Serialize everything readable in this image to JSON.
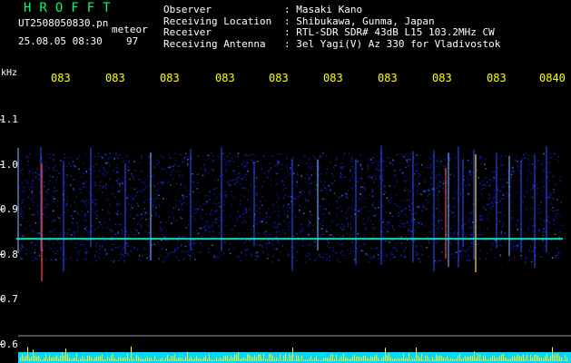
{
  "header": {
    "brand": "HROFFT",
    "filename": "UT2508050830.pn",
    "tag": "meteor",
    "datetime": "25.08.05 08:30",
    "count": "97",
    "info": [
      {
        "label": "Observer",
        "value": ": Masaki Kano"
      },
      {
        "label": "Receiving Location",
        "value": ": Shibukawa, Gunma, Japan"
      },
      {
        "label": "Receiver",
        "value": ": RTL-SDR SDR# 43dB L15 103.2MHz CW"
      },
      {
        "label": "Receiving Antenna",
        "value": ": 3el Yagi(V) Az 330 for Vladivostok"
      }
    ]
  },
  "spectrogram": {
    "y_unit": "kHz",
    "y_ticks": [
      "1.1",
      "1.0",
      "0.9",
      "0.8",
      "0.7",
      "0.6"
    ],
    "x_ticks": [
      "083",
      "083",
      "083",
      "083",
      "083",
      "083",
      "083",
      "083",
      "083",
      "0840"
    ],
    "carrier_khz": 0.835,
    "colors": {
      "text": "#ffffff",
      "brand": "#00ff66",
      "accent": "#ffff00",
      "axis": "#ffff00",
      "carrier": "#19e6c8",
      "noise": "#1a1fd6",
      "level_bar": "#00d8ff",
      "level_spike": "#ffff00"
    }
  }
}
